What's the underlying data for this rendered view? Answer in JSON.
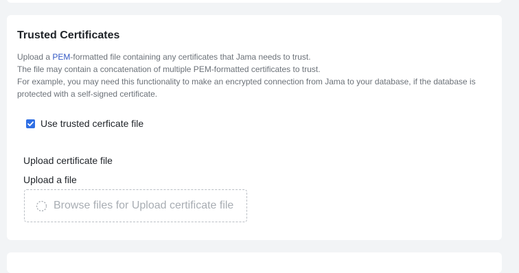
{
  "section": {
    "title": "Trusted Certificates",
    "description": {
      "line1_prefix": "Upload a ",
      "line1_link": "PEM",
      "line1_suffix": "-formatted file containing any certificates that Jama needs to trust.",
      "line2": "The file may contain a concatenation of multiple PEM-formatted certificates to trust.",
      "line3": "For example, you may need this functionality to make an encrypted connection from Jama to your database, if the database is protected with a self-signed certificate."
    },
    "checkbox": {
      "label": "Use trusted cerficate file",
      "checked": true
    },
    "upload": {
      "field_label": "Upload certificate file",
      "sub_label": "Upload a file",
      "dropzone_text": "Browse files for Upload certificate file",
      "icon": "upload-spinner-icon"
    }
  },
  "colors": {
    "accent": "#2f6fe4",
    "link": "#3358c4",
    "background": "#f2f4f6"
  }
}
